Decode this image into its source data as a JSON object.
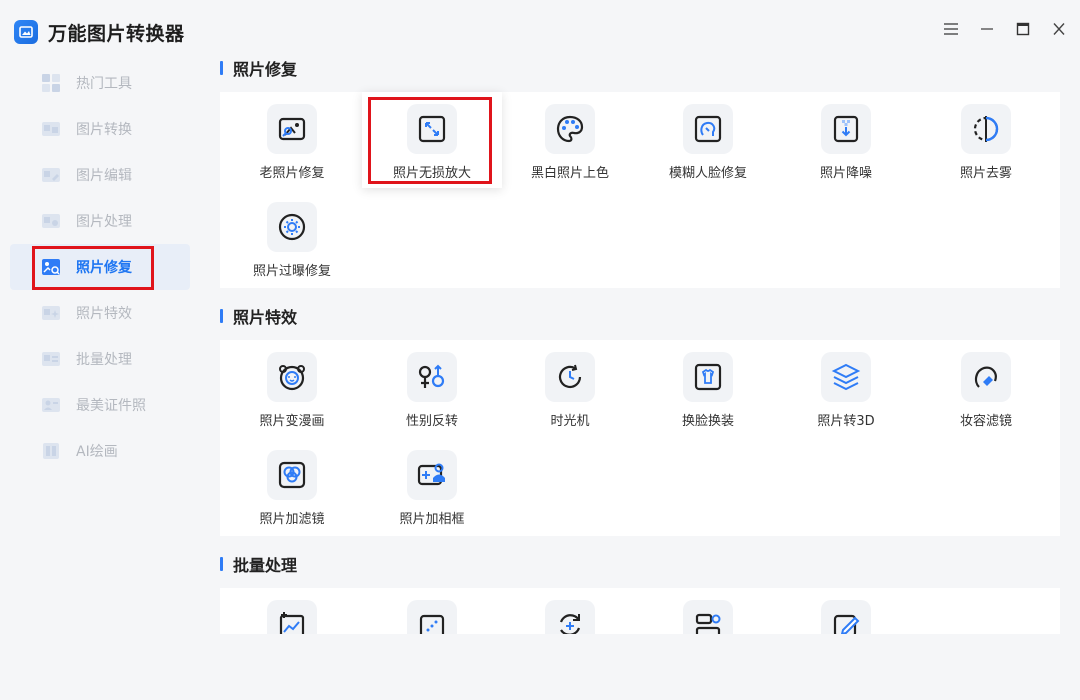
{
  "app": {
    "name": "万能图片转换器"
  },
  "sidebar": {
    "items": [
      {
        "label": "热门工具",
        "icon": "hot-tools-icon"
      },
      {
        "label": "图片转换",
        "icon": "image-convert-icon"
      },
      {
        "label": "图片编辑",
        "icon": "image-edit-icon"
      },
      {
        "label": "图片处理",
        "icon": "image-process-icon"
      },
      {
        "label": "照片修复",
        "icon": "photo-repair-icon",
        "active": true
      },
      {
        "label": "照片特效",
        "icon": "photo-effects-icon"
      },
      {
        "label": "批量处理",
        "icon": "batch-process-icon"
      },
      {
        "label": "最美证件照",
        "icon": "id-photo-icon"
      },
      {
        "label": "AI绘画",
        "icon": "ai-painting-icon"
      }
    ]
  },
  "sections": {
    "repair": {
      "title": "照片修复",
      "tools": [
        {
          "label": "老照片修复",
          "icon": "old-photo-icon"
        },
        {
          "label": "照片无损放大",
          "icon": "expand-arrows-icon"
        },
        {
          "label": "黑白照片上色",
          "icon": "palette-icon"
        },
        {
          "label": "模糊人脸修复",
          "icon": "face-repair-icon"
        },
        {
          "label": "照片降噪",
          "icon": "denoise-icon"
        },
        {
          "label": "照片去雾",
          "icon": "dehaze-icon"
        },
        {
          "label": "照片过曝修复",
          "icon": "sun-icon"
        }
      ]
    },
    "effects": {
      "title": "照片特效",
      "tools": [
        {
          "label": "照片变漫画",
          "icon": "bear-face-icon"
        },
        {
          "label": "性别反转",
          "icon": "gender-icon"
        },
        {
          "label": "时光机",
          "icon": "clock-icon"
        },
        {
          "label": "换脸换装",
          "icon": "shirt-icon"
        },
        {
          "label": "照片转3D",
          "icon": "layers-icon"
        },
        {
          "label": "妆容滤镜",
          "icon": "makeup-icon"
        },
        {
          "label": "照片加滤镜",
          "icon": "filter-circles-icon"
        },
        {
          "label": "照片加相框",
          "icon": "photo-frame-icon"
        }
      ]
    },
    "batch": {
      "title": "批量处理"
    }
  },
  "colors": {
    "accent": "#1f76f2",
    "highlight": "#e0141b"
  }
}
